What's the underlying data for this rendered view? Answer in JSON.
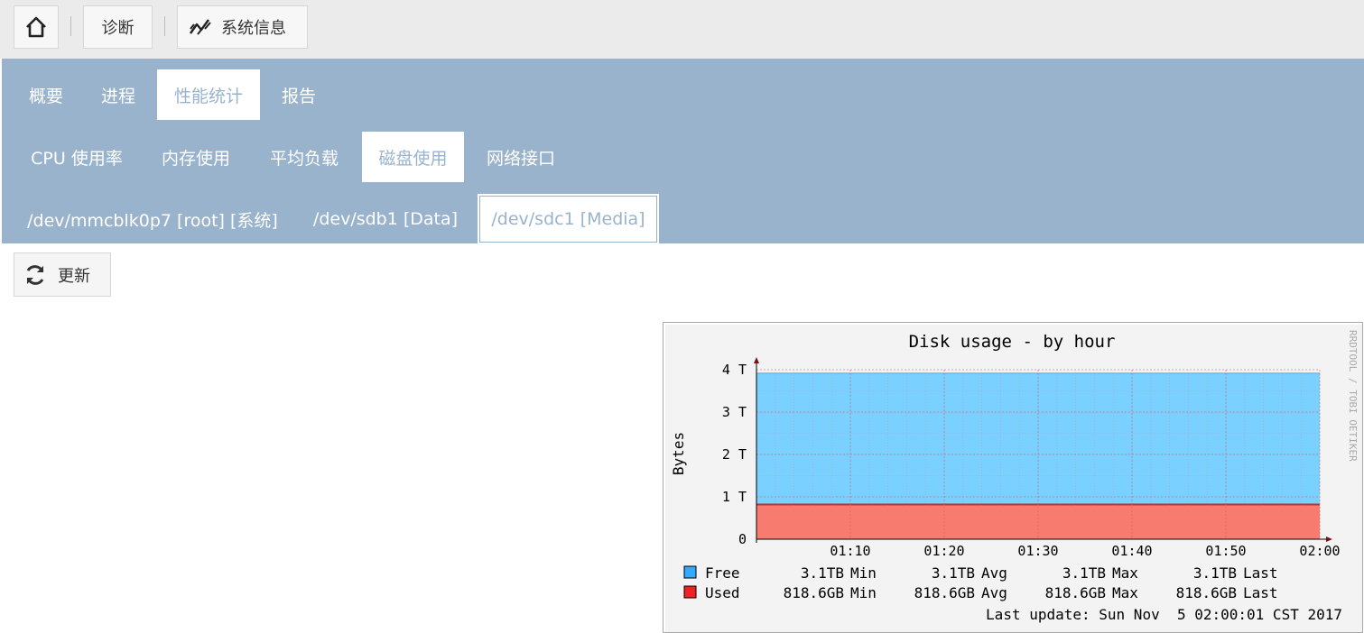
{
  "breadcrumb": {
    "home_icon": "home-icon",
    "diagnostics": "诊断",
    "system_info": "系统信息",
    "system_info_icon": "chart-line-icon"
  },
  "tabs_level1": [
    {
      "label": "概要",
      "active": false
    },
    {
      "label": "进程",
      "active": false
    },
    {
      "label": "性能统计",
      "active": true
    },
    {
      "label": "报告",
      "active": false
    }
  ],
  "tabs_level2": [
    {
      "label": "CPU 使用率",
      "active": false
    },
    {
      "label": "内存使用",
      "active": false
    },
    {
      "label": "平均负载",
      "active": false
    },
    {
      "label": "磁盘使用",
      "active": true
    },
    {
      "label": "网络接口",
      "active": false
    }
  ],
  "tabs_level3": [
    {
      "label": "/dev/mmcblk0p7 [root] [系统]",
      "active": false
    },
    {
      "label": "/dev/sdb1 [Data]",
      "active": false
    },
    {
      "label": "/dev/sdc1 [Media]",
      "active": true
    }
  ],
  "refresh": {
    "label": "更新",
    "icon": "refresh-icon"
  },
  "colors": {
    "panel": "#99b3cc",
    "free_fill": "#7ad0ff",
    "free_legend": "#33aaff",
    "used_fill": "#f87b70",
    "used_legend": "#ee2222"
  },
  "chart_data": {
    "type": "area",
    "title": "Disk usage - by hour",
    "ylabel": "Bytes",
    "watermark": "RRDTOOL / TOBI OETIKER",
    "ylim": [
      0,
      4
    ],
    "y_unit": "T",
    "y_ticks": [
      "0",
      "1 T",
      "2 T",
      "3 T",
      "4 T"
    ],
    "x_ticks": [
      "01:10",
      "01:20",
      "01:30",
      "01:40",
      "01:50",
      "02:00"
    ],
    "grid": true,
    "series": [
      {
        "name": "Used",
        "value_tb": 0.8186,
        "color": "#f87b70",
        "min": "818.6GB",
        "avg": "818.6GB",
        "max": "818.6GB",
        "last": "818.6GB"
      },
      {
        "name": "Free",
        "value_tb": 3.1,
        "color": "#7ad0ff",
        "min": "3.1TB",
        "avg": "3.1TB",
        "max": "3.1TB",
        "last": "3.1TB"
      }
    ],
    "stat_labels": {
      "min": "Min",
      "avg": "Avg",
      "max": "Max",
      "last": "Last"
    },
    "last_update": "Last update: Sun Nov  5 02:00:01 CST 2017"
  }
}
